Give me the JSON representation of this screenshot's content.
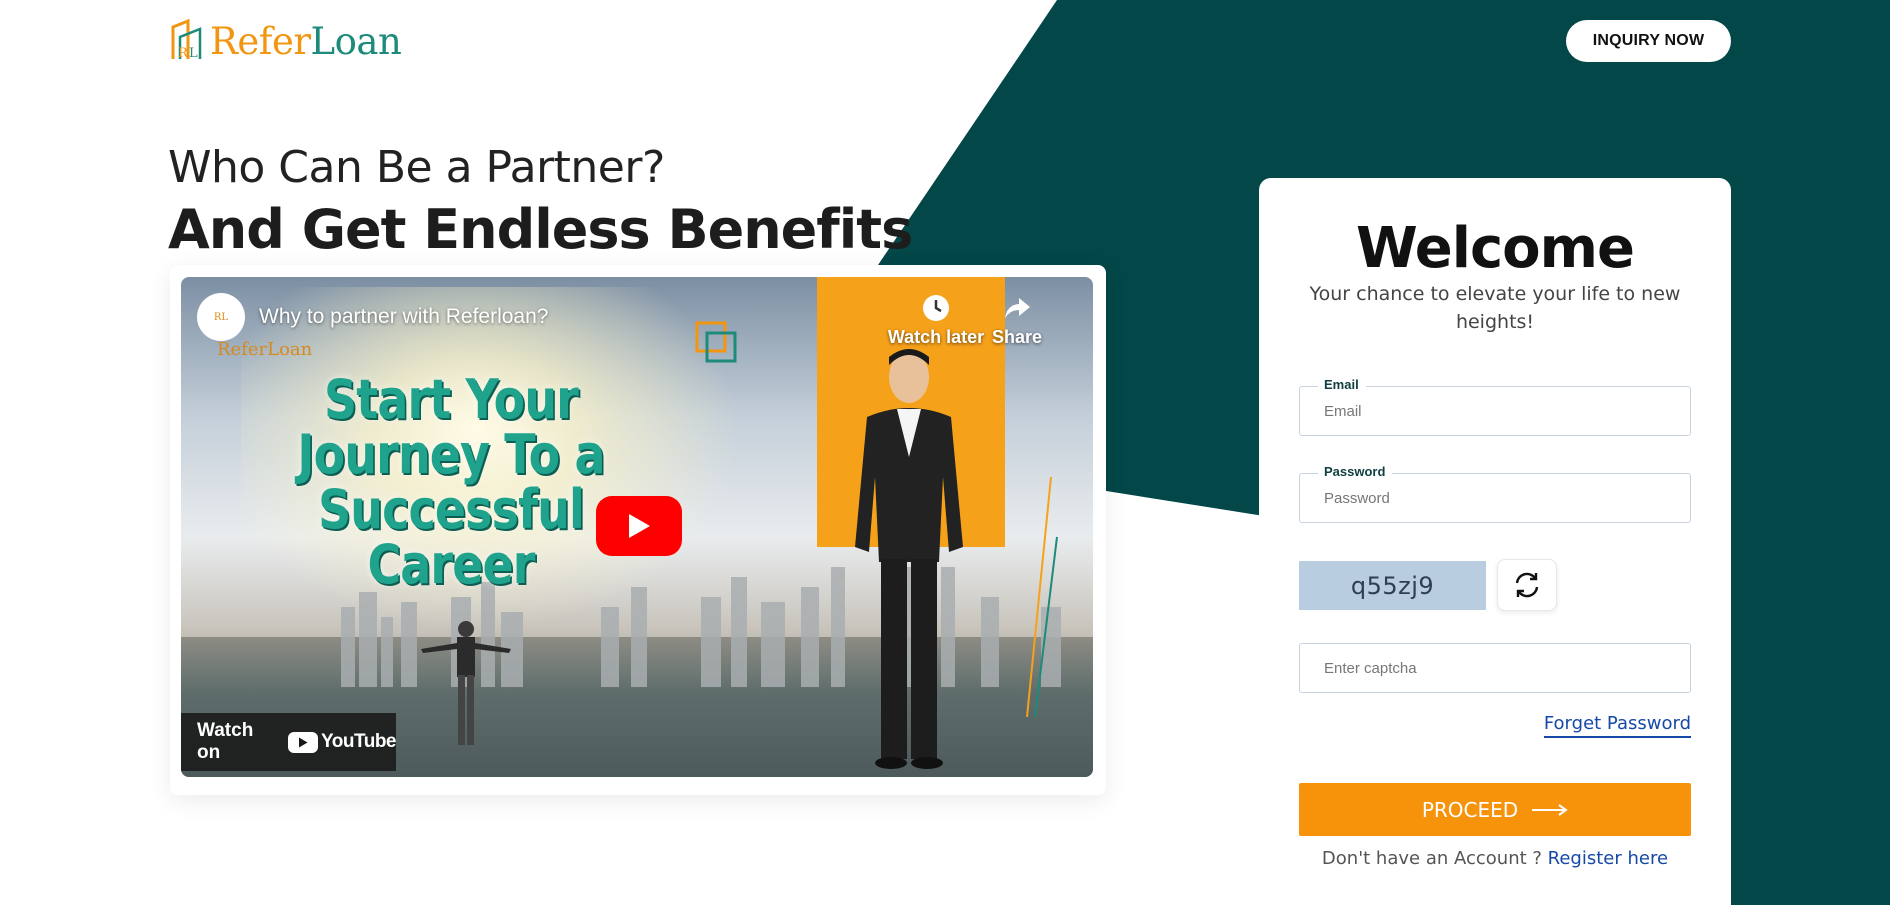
{
  "brand": {
    "part1": "Refer",
    "part2": "Loan"
  },
  "header": {
    "inquiry_label": "INQUIRY NOW"
  },
  "hero": {
    "subtitle": "Who Can Be a Partner?",
    "title": "And Get Endless Benefits"
  },
  "video": {
    "title": "Why to partner with Referloan?",
    "logo_text": "ReferLoan",
    "headline": "Start Your Journey To a Successful Career",
    "watch_later": "Watch later",
    "share": "Share",
    "watch_on": "Watch on",
    "youtube": "YouTube"
  },
  "login": {
    "heading": "Welcome",
    "subheading": "Your chance to elevate your life to new heights!",
    "email_label": "Email",
    "email_placeholder": "Email",
    "password_label": "Password",
    "password_placeholder": "Password",
    "captcha_code": "q55zj9",
    "captcha_placeholder": "Enter captcha",
    "forget_label": "Forget Password",
    "proceed_label": "PROCEED",
    "no_account_text": "Don't have an Account ? ",
    "register_label": "Register here"
  },
  "colors": {
    "teal": "#004848",
    "orange": "#f7930a",
    "link": "#1649a7"
  }
}
